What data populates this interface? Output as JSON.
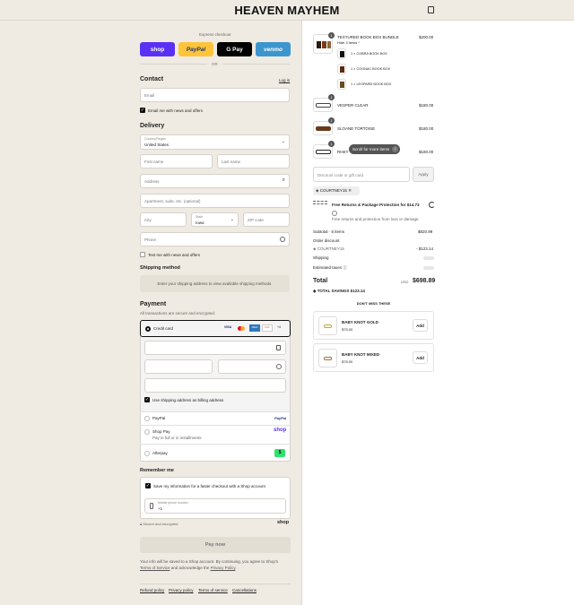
{
  "header": {
    "brand": "HEAVEN MAYHEM",
    "cart_icon": "bag-icon"
  },
  "express": {
    "title": "Express checkout",
    "shop": "shop",
    "paypal": "PayPal",
    "gpay": "G Pay",
    "venmo": "venmo",
    "or": "OR",
    "colors": {
      "shop": "#5a31f4",
      "paypal": "#ffc439",
      "gpay": "#000000",
      "venmo": "#3d95ce"
    }
  },
  "contact": {
    "title": "Contact",
    "login": "Log in",
    "email_placeholder": "Email",
    "news": "Email me with news and offers"
  },
  "delivery": {
    "title": "Delivery",
    "country_label": "Country/Region",
    "country_value": "United States",
    "first": "First name",
    "last": "Last name",
    "address": "Address",
    "apt": "Apartment, suite, etc. (optional)",
    "city": "City",
    "state_label": "State",
    "state_value": "Iowa",
    "zip": "ZIP code",
    "phone": "Phone",
    "text_news": "Text me with news and offers"
  },
  "shipping": {
    "title": "Shipping method",
    "note": "Enter your shipping address to view available shipping methods."
  },
  "payment": {
    "title": "Payment",
    "subtitle": "All transactions are secure and encrypted.",
    "credit_card": "Credit card",
    "card_brands": [
      "VISA",
      "MC",
      "AMEX",
      "DISC",
      "+4"
    ],
    "billing": "Use shipping address as billing address",
    "paypal": "PayPal",
    "paypal_logo": "PayPal",
    "shoppay": "Shop Pay",
    "shoppay_sub": "Pay in full or in installments",
    "shop_logo": "shop",
    "afterpay": "Afterpay",
    "afterpay_logo": "$"
  },
  "remember": {
    "title": "Remember me",
    "save": "Save my information for a faster checkout with a Shop account",
    "mobile_label": "Mobile phone number",
    "mobile_value": "+1",
    "secure": "Secure and encrypted",
    "shop_brand": "shop"
  },
  "pay_now": "Pay now",
  "terms": {
    "line1": "Your info will be saved to a Shop account. By continuing, you agree to Shop's",
    "tos": "Terms of Service",
    "mid": "and acknowledge the",
    "privacy": "Privacy Policy",
    "end": "."
  },
  "footer": [
    "Refund policy",
    "Privacy policy",
    "Terms of service",
    "Cancellations"
  ],
  "cart": {
    "bundle": {
      "qty": "1",
      "name": "TEXTURED BOOK BOX BUNDLE",
      "price": "$200.00",
      "hide": "Hide 3 items ^",
      "items": [
        "1 × COBRA BOOK BOX",
        "1 × COGNAC BOOK BOX",
        "1 × LEOPARD BOOK BOX"
      ]
    },
    "items": [
      {
        "qty": "1",
        "name": "VESPER CLEAR",
        "price": "$180.00"
      },
      {
        "qty": "1",
        "name": "SLOANE TORTOISE",
        "price": "$180.00"
      },
      {
        "qty": "1",
        "name": "RHEY",
        "price": "$180.00"
      }
    ],
    "scroll_hint": "Scroll for more items",
    "discount_placeholder": "Discount code or gift card",
    "apply": "Apply",
    "code": "COURTNEY15",
    "protection": {
      "title": "Free Returns & Package Protection for $14.73",
      "sub": "Free returns and protection from loss or damage"
    },
    "subtotal_label": "Subtotal · 6 items",
    "subtotal": "$820.99",
    "order_discount": "Order discount",
    "discount_code": "COURTNEY15",
    "discount_amount": "- $123.14",
    "shipping": "Shipping",
    "taxes": "Estimated taxes",
    "total_label": "Total",
    "currency": "USD",
    "total": "$698.89",
    "savings_label": "TOTAL SAVINGS",
    "savings": "$123.14",
    "upsell_title": "DON'T MISS THESE",
    "upsells": [
      {
        "name": "BABY KNOT GOLD",
        "price": "$75.00",
        "add": "Add"
      },
      {
        "name": "BABY KNOT MIXED",
        "price": "$75.00",
        "add": "Add"
      }
    ]
  }
}
